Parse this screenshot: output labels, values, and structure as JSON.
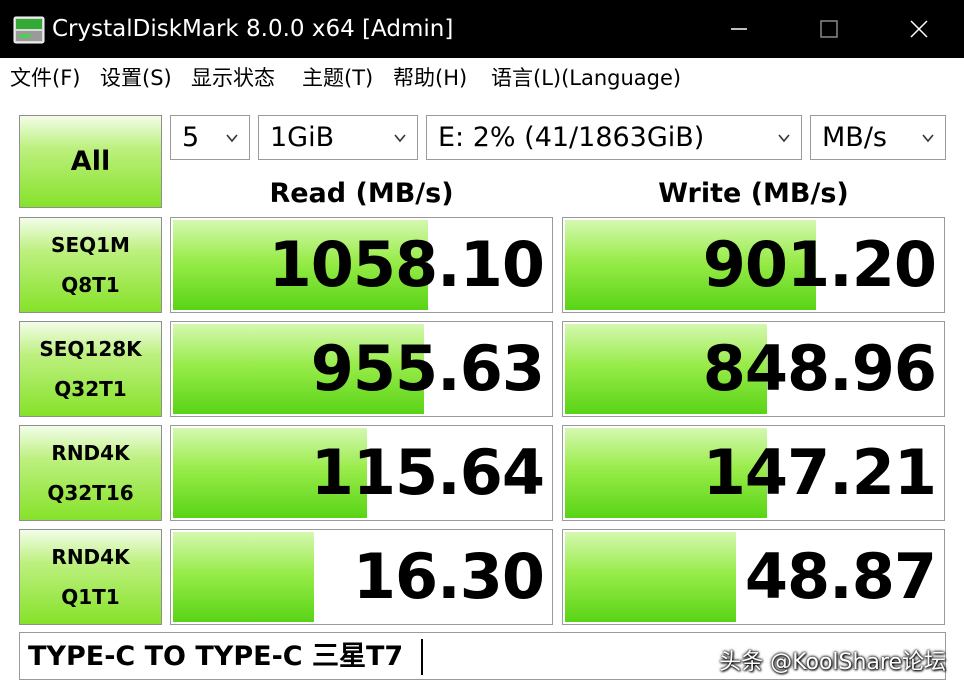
{
  "window": {
    "title": "CrystalDiskMark 8.0.0 x64 [Admin]",
    "controls": {
      "minimize": "—",
      "maximize": "□",
      "close": "✕"
    }
  },
  "menu": [
    {
      "label": "文件(F)"
    },
    {
      "label": "设置(S)"
    },
    {
      "label": "显示状态"
    },
    {
      "label": "主题(T)"
    },
    {
      "label": "帮助(H)"
    },
    {
      "label": "语言(L)(Language)"
    }
  ],
  "toolbar": {
    "all_label": "All",
    "count": "5",
    "size": "1GiB",
    "drive": "E: 2% (41/1863GiB)",
    "unit": "MB/s"
  },
  "headers": {
    "read": "Read (MB/s)",
    "write": "Write (MB/s)"
  },
  "tests": [
    {
      "line1": "SEQ1M",
      "line2": "Q8T1",
      "read": "1058.10",
      "write": "901.20",
      "read_fill": 0.67,
      "write_fill": 0.66
    },
    {
      "line1": "SEQ128K",
      "line2": "Q32T1",
      "read": "955.63",
      "write": "848.96",
      "read_fill": 0.66,
      "write_fill": 0.53
    },
    {
      "line1": "RND4K",
      "line2": "Q32T16",
      "read": "115.64",
      "write": "147.21",
      "read_fill": 0.51,
      "write_fill": 0.53
    },
    {
      "line1": "RND4K",
      "line2": "Q1T1",
      "read": "16.30",
      "write": "48.87",
      "read_fill": 0.37,
      "write_fill": 0.45
    }
  ],
  "comment": "TYPE-C TO TYPE-C 三星T7",
  "watermark": "头条 @KoolShare论坛",
  "colors": {
    "accent_green": "#59d416",
    "titlebar": "#000000"
  },
  "icons": {
    "app": "disk-icon",
    "dropdown": "chevron-down-icon"
  }
}
